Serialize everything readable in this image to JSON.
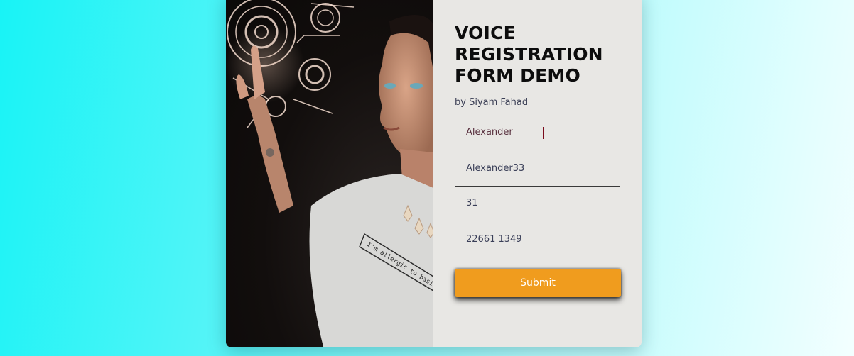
{
  "form": {
    "title": "VOICE REGISTRATION FORM DEMO",
    "byline": "by Siyam Fahad",
    "fields": [
      {
        "value": "Alexander"
      },
      {
        "value": "Alexander33"
      },
      {
        "value": "31"
      },
      {
        "value": "22661 1349"
      }
    ],
    "submit_label": "Submit"
  },
  "photo": {
    "shirt_text": "I'm allergic to basi"
  },
  "colors": {
    "background_start": "#18f3f6",
    "background_end": "#f3ffff",
    "panel": "#e8e7e4",
    "accent": "#f09c1e"
  }
}
